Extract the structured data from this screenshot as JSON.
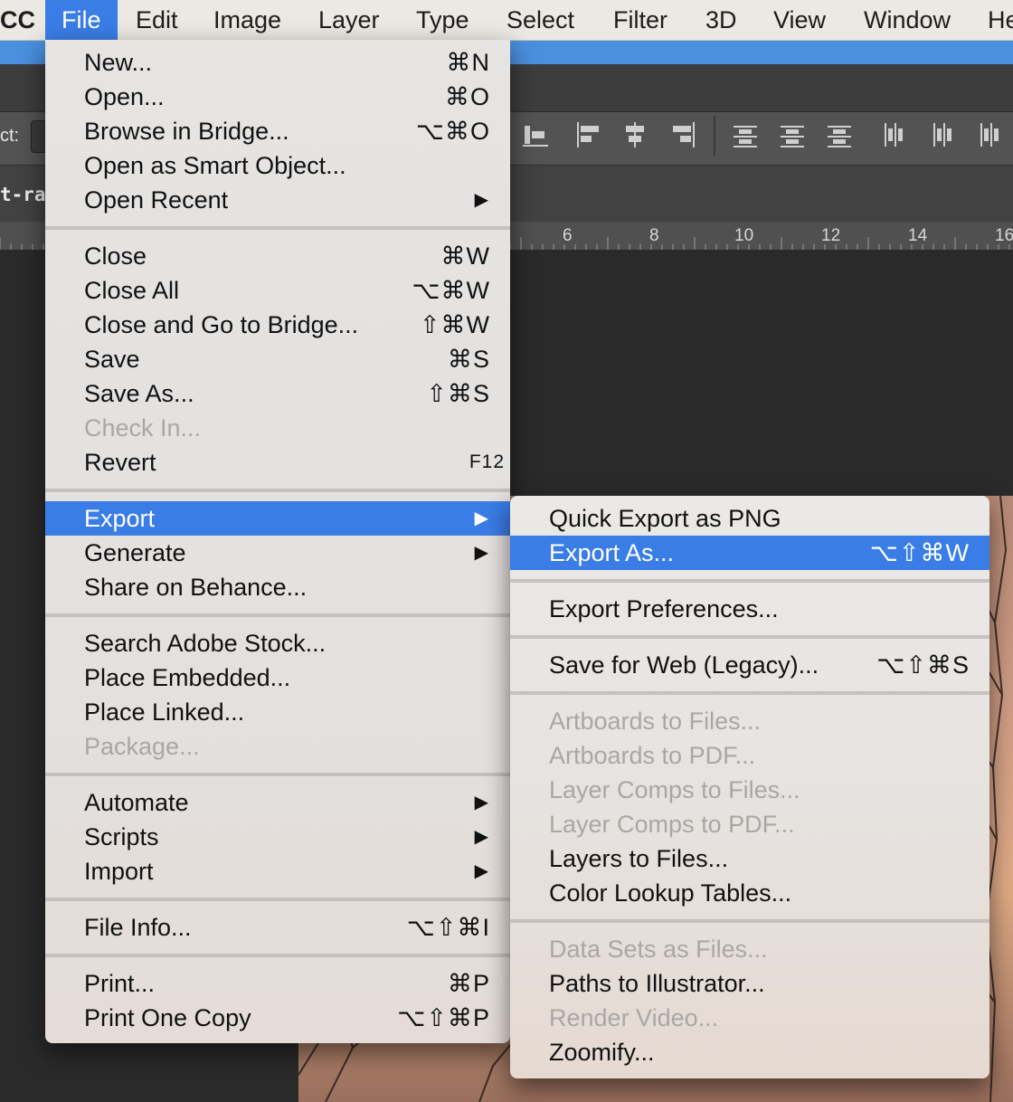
{
  "menubar": {
    "app": "CC",
    "items": [
      "File",
      "Edit",
      "Image",
      "Layer",
      "Type",
      "Select",
      "Filter",
      "3D",
      "View",
      "Window",
      "He"
    ]
  },
  "background": {
    "options_label": "ct:",
    "doc_tab": "t-ras",
    "ruler_ticks": [
      "6",
      "8",
      "10",
      "12",
      "14",
      "16"
    ]
  },
  "file_menu": {
    "groups": [
      [
        {
          "label": "New...",
          "shortcut": "⌘N"
        },
        {
          "label": "Open...",
          "shortcut": "⌘O"
        },
        {
          "label": "Browse in Bridge...",
          "shortcut": "⌥⌘O"
        },
        {
          "label": "Open as Smart Object...",
          "shortcut": ""
        },
        {
          "label": "Open Recent",
          "submenu": true
        }
      ],
      [
        {
          "label": "Close",
          "shortcut": "⌘W"
        },
        {
          "label": "Close All",
          "shortcut": "⌥⌘W"
        },
        {
          "label": "Close and Go to Bridge...",
          "shortcut": "⇧⌘W"
        },
        {
          "label": "Save",
          "shortcut": "⌘S"
        },
        {
          "label": "Save As...",
          "shortcut": "⇧⌘S"
        },
        {
          "label": "Check In...",
          "disabled": true
        },
        {
          "label": "Revert",
          "shortcut": "F12"
        }
      ],
      [
        {
          "label": "Export",
          "submenu": true,
          "highlighted": true
        },
        {
          "label": "Generate",
          "submenu": true
        },
        {
          "label": "Share on Behance...",
          "shortcut": ""
        }
      ],
      [
        {
          "label": "Search Adobe Stock...",
          "shortcut": ""
        },
        {
          "label": "Place Embedded...",
          "shortcut": ""
        },
        {
          "label": "Place Linked...",
          "shortcut": ""
        },
        {
          "label": "Package...",
          "disabled": true
        }
      ],
      [
        {
          "label": "Automate",
          "submenu": true
        },
        {
          "label": "Scripts",
          "submenu": true
        },
        {
          "label": "Import",
          "submenu": true
        }
      ],
      [
        {
          "label": "File Info...",
          "shortcut": "⌥⇧⌘I"
        }
      ],
      [
        {
          "label": "Print...",
          "shortcut": "⌘P"
        },
        {
          "label": "Print One Copy",
          "shortcut": "⌥⇧⌘P"
        }
      ]
    ]
  },
  "export_menu": {
    "groups": [
      [
        {
          "label": "Quick Export as PNG",
          "shortcut": ""
        },
        {
          "label": "Export As...",
          "shortcut": "⌥⇧⌘W",
          "highlighted": true
        }
      ],
      [
        {
          "label": "Export Preferences...",
          "shortcut": ""
        }
      ],
      [
        {
          "label": "Save for Web (Legacy)...",
          "shortcut": "⌥⇧⌘S"
        }
      ],
      [
        {
          "label": "Artboards to Files...",
          "disabled": true
        },
        {
          "label": "Artboards to PDF...",
          "disabled": true
        },
        {
          "label": "Layer Comps to Files...",
          "disabled": true
        },
        {
          "label": "Layer Comps to PDF...",
          "disabled": true
        },
        {
          "label": "Layers to Files...",
          "shortcut": ""
        },
        {
          "label": "Color Lookup Tables...",
          "shortcut": ""
        }
      ],
      [
        {
          "label": "Data Sets as Files...",
          "disabled": true
        },
        {
          "label": "Paths to Illustrator...",
          "shortcut": ""
        },
        {
          "label": "Render Video...",
          "disabled": true
        },
        {
          "label": "Zoomify...",
          "shortcut": ""
        }
      ]
    ]
  },
  "icons": {
    "submenu": "submenu-arrow-icon",
    "align": "align-distribute-icon"
  },
  "colors": {
    "highlight": "#3a7de7",
    "menubar": "#ece8e3",
    "menu_bg": "#e5e3e1",
    "disabled_text": "#a9a7a5"
  }
}
